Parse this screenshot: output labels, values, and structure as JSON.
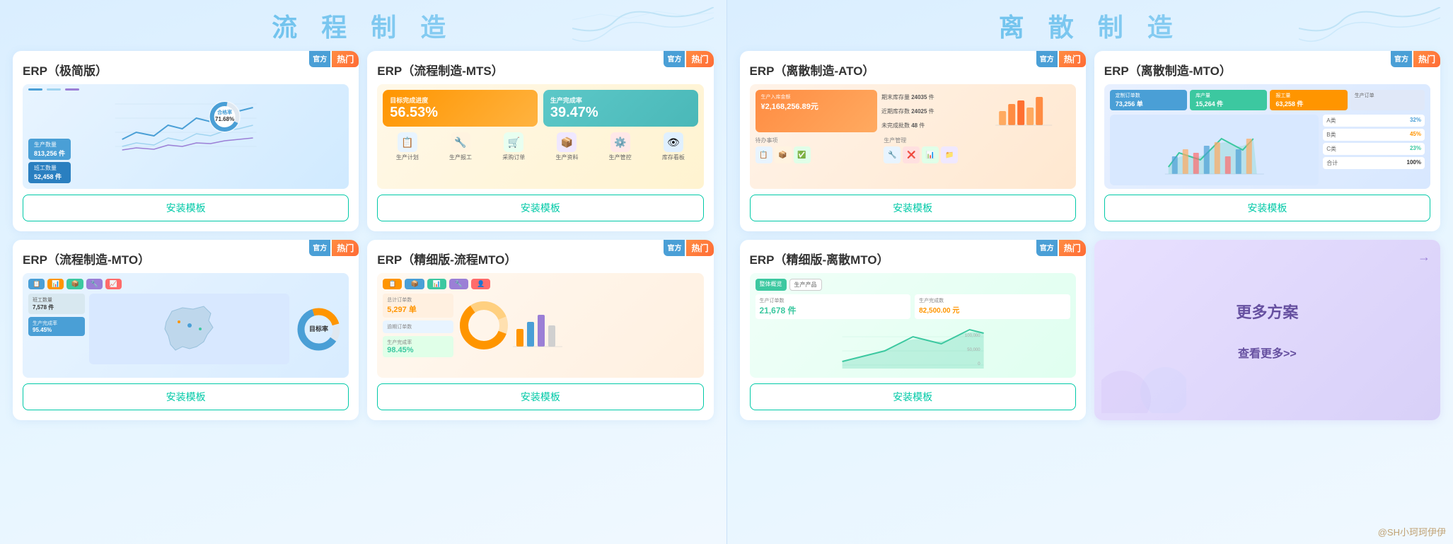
{
  "sections": [
    {
      "id": "liucheng",
      "title": "流 程 制 造",
      "cards": [
        {
          "id": "erp-jijian",
          "title": "ERP（极简版）",
          "badge_official": "官方",
          "badge_hot": "热门",
          "install_label": "安装模板",
          "type": "jijian"
        },
        {
          "id": "erp-mts",
          "title": "ERP（流程制造-MTS）",
          "badge_official": "官方",
          "badge_hot": "热门",
          "install_label": "安装模板",
          "type": "mts",
          "kpi1_val": "56.53%",
          "kpi1_label": "目标完成进度",
          "kpi2_val": "39.47%",
          "kpi2_label": "生产完成率",
          "icons": [
            "生产计划",
            "生产报工",
            "采购订单",
            "生产资料",
            "生产管控",
            "库存看板"
          ]
        },
        {
          "id": "erp-lc-mto",
          "title": "ERP（流程制造-MTO）",
          "badge_official": "官方",
          "badge_hot": "热门",
          "install_label": "安装模板",
          "type": "lc-mto"
        },
        {
          "id": "erp-jx-lc",
          "title": "ERP（精细版-流程MTO）",
          "badge_official": "官方",
          "badge_hot": "热门",
          "install_label": "安装模板",
          "type": "jx-lc",
          "stats": [
            {
              "label": "总计订单数",
              "val": "5,297 单"
            },
            {
              "label": "逾期订单数",
              "val": ""
            },
            {
              "label": "生产完成率",
              "val": "98.45%"
            }
          ]
        }
      ]
    },
    {
      "id": "lisanzhizao",
      "title": "离 散 制 造",
      "cards": [
        {
          "id": "erp-ato",
          "title": "ERP（离散制造-ATO）",
          "badge_official": "官方",
          "badge_hot": "热门",
          "install_label": "安装模板",
          "type": "ato",
          "amount": "¥2,168,256.89元",
          "amount_label": "生产入库金额",
          "stats": [
            "期末库存量 24035件",
            "近期库存数 24025件",
            "未完成批数 48件"
          ]
        },
        {
          "id": "erp-dis-mto",
          "title": "ERP（离散制造-MTO）",
          "badge_official": "官方",
          "badge_hot": "热门",
          "install_label": "安装模板",
          "type": "dis-mto",
          "stats": [
            "73,256单",
            "15,264件",
            "63,258件"
          ]
        },
        {
          "id": "erp-jx-dis",
          "title": "ERP（精细版-离散MTO）",
          "badge_official": "官方",
          "badge_hot": "热门",
          "install_label": "安装模板",
          "type": "jx-dis",
          "stats": [
            {
              "label": "生产订单数",
              "val": "21,678件"
            },
            {
              "label": "生产完成数",
              "val": "82,500.00元"
            }
          ]
        },
        {
          "id": "more",
          "title": "更多方案",
          "type": "more",
          "link_label": "查看更多>>",
          "arrow": "→"
        }
      ]
    }
  ],
  "watermark": "@SH小珂珂伊伊",
  "install_label": "安装模板 >"
}
